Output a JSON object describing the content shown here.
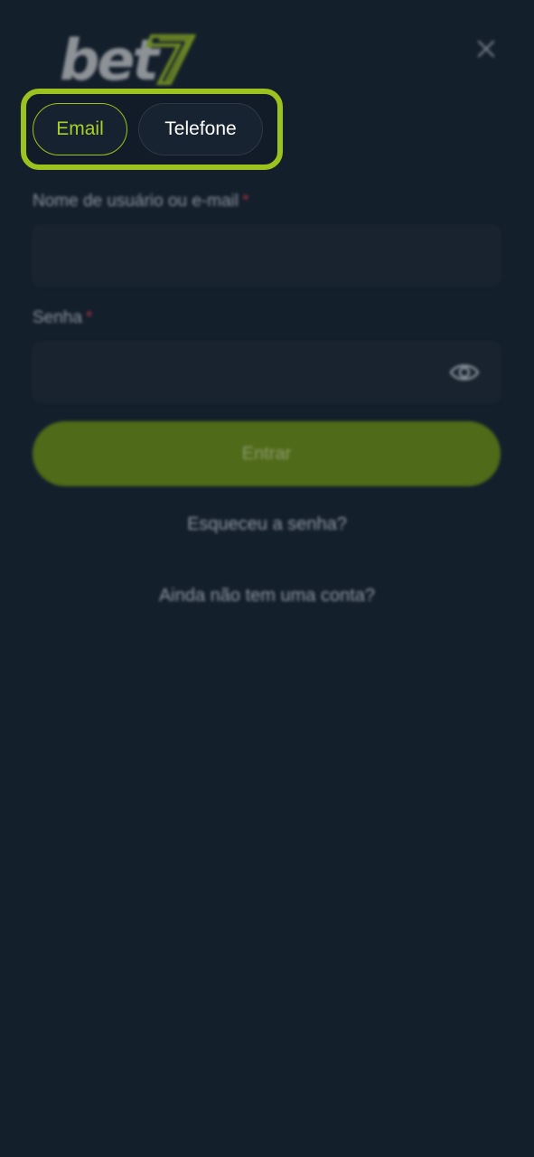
{
  "header": {
    "logo_text": "bet7",
    "close_icon": "close-icon"
  },
  "tabs": [
    {
      "label": "Email",
      "selected": true
    },
    {
      "label": "Telefone",
      "selected": false
    }
  ],
  "form": {
    "username_label": "Nome de usuário ou e-mail",
    "username_value": "",
    "username_placeholder": "",
    "password_label": "Senha",
    "password_value": "",
    "password_placeholder": "",
    "required_marker": "*",
    "toggle_visibility_icon": "eye-icon",
    "submit_label": "Entrar"
  },
  "links": {
    "forgot_password": "Esqueceu a senha?",
    "no_account": "Ainda não tem uma conta?"
  },
  "colors": {
    "background": "#141f2c",
    "accent": "#9bc21e",
    "submit_button": "#4f6a18",
    "required": "#a3343c"
  }
}
